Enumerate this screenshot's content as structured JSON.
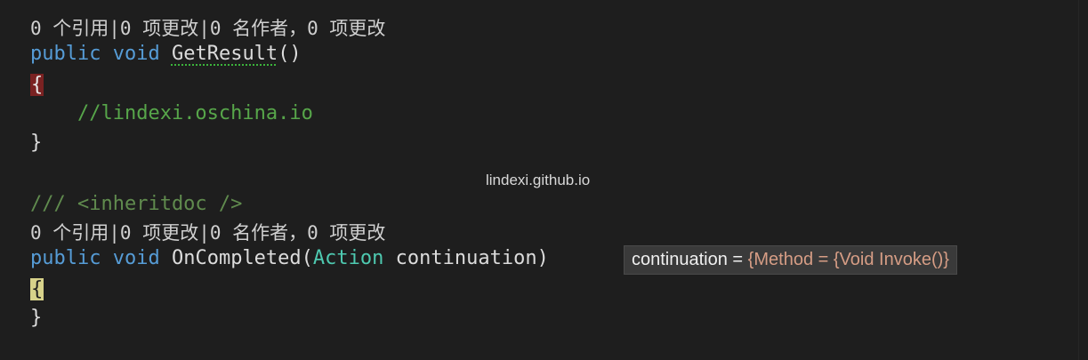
{
  "editor": {
    "lens1": "0 个引用|0 项更改|0 名作者，0 项更改",
    "kw_public": "public",
    "kw_void": "void",
    "method1_name": "GetResult",
    "method1_parens": "()",
    "open_brace": "{",
    "close_brace": "}",
    "comment1": "//lindexi.oschina.io",
    "xml_comment": "/// <inheritdoc />",
    "lens2": "0 个引用|0 项更改|0 名作者，0 项更改",
    "method2_name": "OnCompleted",
    "method2_open": "(",
    "param_type": "Action",
    "param_name": "continuation",
    "method2_close": ")"
  },
  "watermark": "lindexi.github.io",
  "datatip": {
    "name": "continuation",
    "equals": " = ",
    "value": "{Method = {Void Invoke()}"
  },
  "colors": {
    "background": "#1e1e1e",
    "keyword": "#569cd6",
    "type": "#4ec9b0",
    "comment": "#57a64a",
    "brace_match_red": "#7a2222",
    "brace_match_yellow": "#d7d28a"
  }
}
